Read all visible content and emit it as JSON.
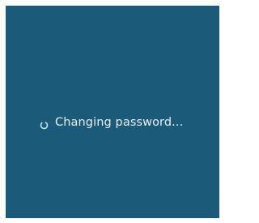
{
  "status": {
    "message": "Changing password...",
    "spinner_icon": "loading-spinner-icon",
    "spinner_color": "#5ad6e6"
  },
  "colors": {
    "background": "#1b5a78",
    "text": "#e6eef2"
  }
}
